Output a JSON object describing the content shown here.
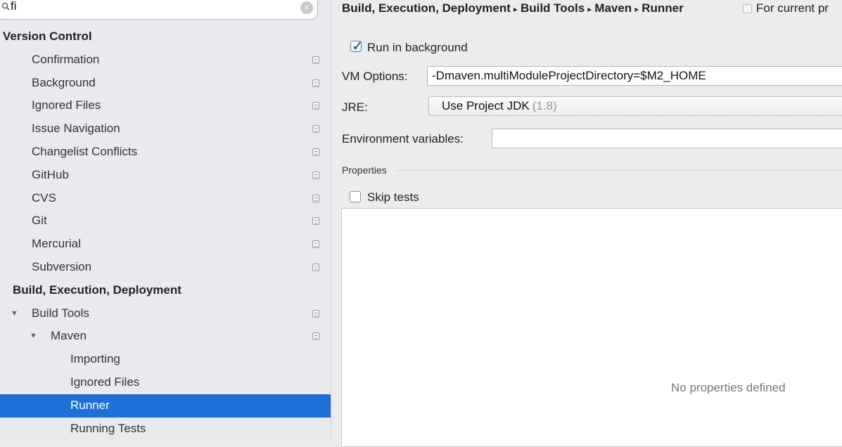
{
  "search": {
    "value": "fi"
  },
  "sidebar": {
    "items": [
      {
        "label": "Version Control",
        "type": "group",
        "indent": 0,
        "name": "version-control"
      },
      {
        "label": "Confirmation",
        "type": "item",
        "indent": 1,
        "name": "confirmation"
      },
      {
        "label": "Background",
        "type": "item",
        "indent": 1,
        "name": "background"
      },
      {
        "label": "Ignored Files",
        "type": "item",
        "indent": 1,
        "name": "ignored-files"
      },
      {
        "label": "Issue Navigation",
        "type": "item",
        "indent": 1,
        "name": "issue-navigation"
      },
      {
        "label": "Changelist Conflicts",
        "type": "item",
        "indent": 1,
        "name": "changelist-conflicts"
      },
      {
        "label": "GitHub",
        "type": "item",
        "indent": 1,
        "name": "github"
      },
      {
        "label": "CVS",
        "type": "item",
        "indent": 1,
        "name": "cvs"
      },
      {
        "label": "Git",
        "type": "item",
        "indent": 1,
        "name": "git"
      },
      {
        "label": "Mercurial",
        "type": "item",
        "indent": 1,
        "name": "mercurial"
      },
      {
        "label": "Subversion",
        "type": "item",
        "indent": 1,
        "name": "subversion"
      },
      {
        "label": "Build, Execution, Deployment",
        "type": "group",
        "indent": 0,
        "name": "build-execution-deployment"
      },
      {
        "label": "Build Tools",
        "type": "expanded",
        "indent": 1,
        "name": "build-tools"
      },
      {
        "label": "Maven",
        "type": "expanded",
        "indent": 2,
        "name": "maven"
      },
      {
        "label": "Importing",
        "type": "leaf",
        "indent": 3,
        "name": "importing"
      },
      {
        "label": "Ignored Files",
        "type": "leaf",
        "indent": 3,
        "name": "maven-ignored-files"
      },
      {
        "label": "Runner",
        "type": "selected",
        "indent": 3,
        "name": "runner"
      },
      {
        "label": "Running Tests",
        "type": "leaf",
        "indent": 3,
        "name": "running-tests"
      }
    ]
  },
  "breadcrumb": {
    "parts": [
      "Build, Execution, Deployment",
      "Build Tools",
      "Maven",
      "Runner"
    ],
    "separator": "▸"
  },
  "for_current_project": "For current pr",
  "runner": {
    "run_in_background_label": "Run in background",
    "run_in_background_checked": true,
    "vm_options_label": "VM Options:",
    "vm_options_value": "-Dmaven.multiModuleProjectDirectory=$M2_HOME",
    "jre_label": "JRE:",
    "jre_value": "Use Project JDK",
    "jre_hint": "(1.8)",
    "env_label": "Environment variables:",
    "env_value": "",
    "properties_title": "Properties",
    "skip_tests_label": "Skip tests",
    "skip_tests_checked": false,
    "empty_properties_text": "No properties defined"
  },
  "colors": {
    "selection": "#1e6fd6",
    "sidebar_bg": "#e8eaee",
    "panel_bg": "#ececec"
  }
}
